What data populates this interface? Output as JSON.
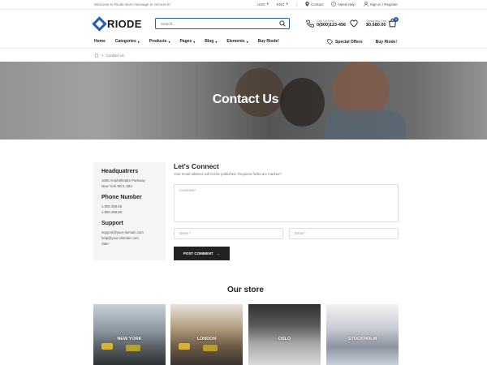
{
  "topbar": {
    "welcome": "Welcome to Riode store message or remove it!",
    "currency": "USD",
    "language": "ENG",
    "contact": "Contact",
    "need_help": "Need Help",
    "sign_in": "Sign in / Register"
  },
  "header": {
    "logo": "RIODE",
    "search_placeholder": "Search...",
    "call_label": "Call Us Now:",
    "call_number": "0(800)123-456",
    "cart_label": "Shopping Cart",
    "cart_amount": "$0,680.00",
    "cart_count": "0"
  },
  "nav": {
    "items": [
      {
        "label": "Home",
        "chevron": ""
      },
      {
        "label": "Categories",
        "chevron": "▾"
      },
      {
        "label": "Products",
        "chevron": "▾"
      },
      {
        "label": "Pages",
        "chevron": "▾"
      },
      {
        "label": "Blog",
        "chevron": "▾"
      },
      {
        "label": "Elements",
        "chevron": "▾"
      },
      {
        "label": "Buy Riode!",
        "chevron": ""
      }
    ],
    "special_offers": "Special Offers",
    "buy_riode": "Buy Riode!"
  },
  "breadcrumb": {
    "sep": ">",
    "current": "Contact Us"
  },
  "hero": {
    "title": "Contact Us"
  },
  "info": {
    "hq_title": "Headquatrers",
    "hq_line1": "1600 Amphitheatre Parkway",
    "hq_line2": "New York WC1 1BA",
    "phone_title": "Phone Number",
    "phone1": "1.800.458.56",
    "phone2": "1.800.458.56",
    "support_title": "Support",
    "support1": "support@your-domain.com",
    "support2": "help@your-domain.com",
    "support3": "Sale"
  },
  "form": {
    "title": "Let's Connect",
    "note": "Your email address will not be published. Required fields are marked *",
    "comment_placeholder": "Comment*",
    "name_placeholder": "Name *",
    "email_placeholder": "Email *",
    "submit": "POST COMMENT",
    "submit_arrow": "→"
  },
  "store": {
    "title": "Our store",
    "cities": [
      "NEW YORK",
      "LONDON",
      "OSLO",
      "STOCKHOLM"
    ]
  },
  "colors": {
    "brand": "#1e5fb0",
    "button": "#222222"
  }
}
